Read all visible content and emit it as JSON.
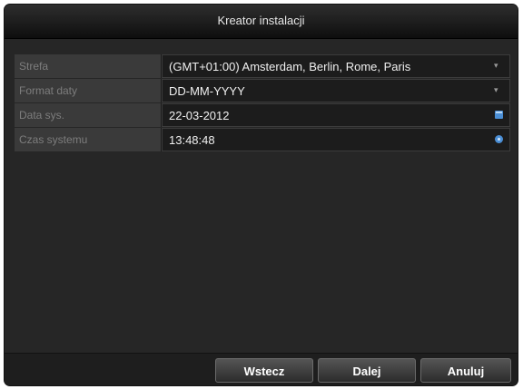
{
  "window": {
    "title": "Kreator instalacji"
  },
  "form": {
    "rows": [
      {
        "label": "Strefa",
        "value": "(GMT+01:00) Amsterdam, Berlin, Rome, Paris",
        "icon": "chevron-down-icon"
      },
      {
        "label": "Format daty",
        "value": "DD-MM-YYYY",
        "icon": "chevron-down-icon"
      },
      {
        "label": "Data sys.",
        "value": "22-03-2012",
        "icon": "calendar-icon"
      },
      {
        "label": "Czas systemu",
        "value": "13:48:48",
        "icon": "clock-icon"
      }
    ]
  },
  "footer": {
    "back_label": "Wstecz",
    "next_label": "Dalej",
    "cancel_label": "Anuluj"
  },
  "colors": {
    "icon_accent": "#4b8fd6",
    "background": "#262626"
  }
}
